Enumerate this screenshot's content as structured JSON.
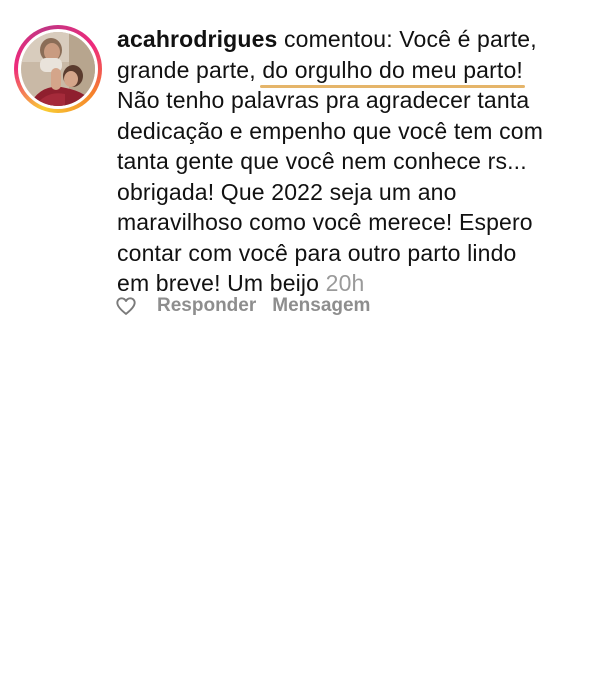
{
  "comment": {
    "username": "acahrodrigues",
    "lines": [
      " comentou: Você é parte,",
      "grande parte, ",
      "do orgulho do meu parto!",
      "Não tenho palavras pra agradecer tanta",
      "dedicação e empenho que você tem com",
      "tanta gente que você nem conhece rs...",
      "obrigada! Que 2022 seja um ano",
      "maravilhoso como você merece! Espero",
      "contar com você para outro parto lindo",
      "em breve! Um beijo "
    ],
    "timestamp": "20h",
    "avatar_icon": "profile-photo-avatar",
    "highlight_color": "#e5b56a",
    "story_ring_colors": [
      "#f9ce34",
      "#ee2a7b",
      "#c13584",
      "#f58529"
    ]
  },
  "actions": {
    "like_icon": "heart-outline-icon",
    "reply_label": "Responder",
    "message_label": "Mensagem"
  }
}
